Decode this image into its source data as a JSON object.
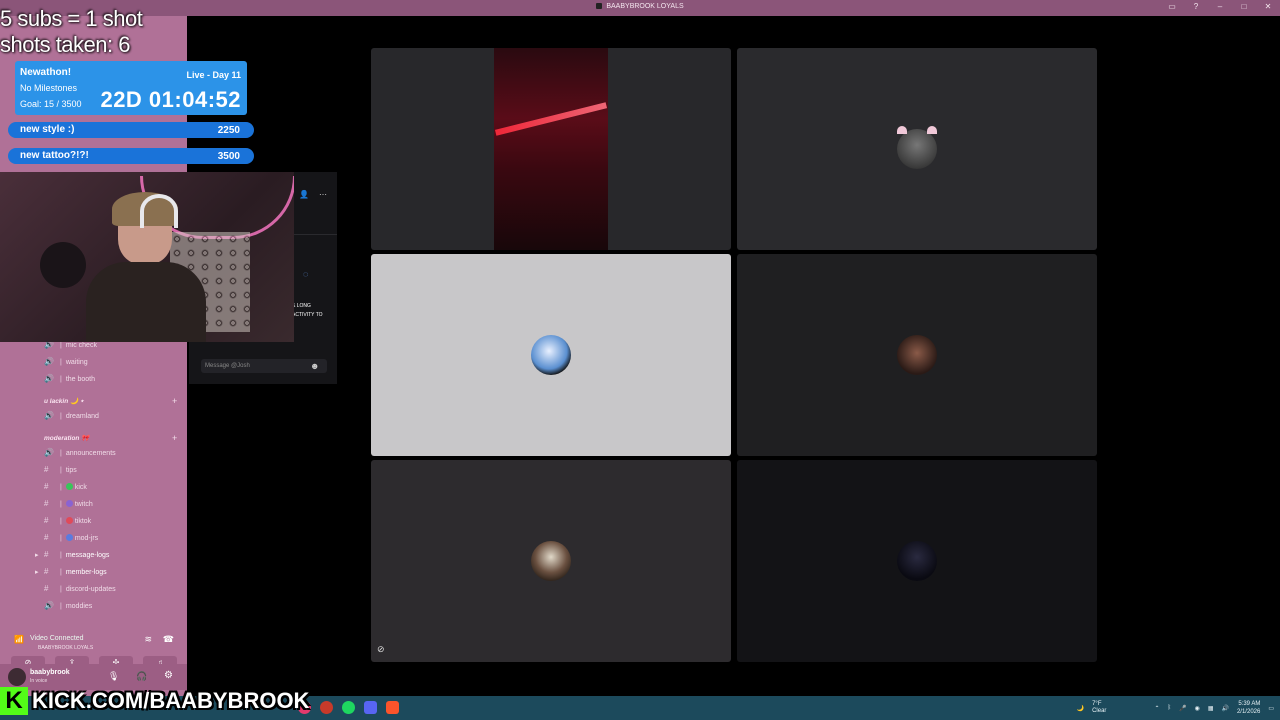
{
  "window": {
    "title": "BAABYBROOK LOYALS",
    "controls": [
      "▭",
      "?",
      "–",
      "□",
      "✕"
    ]
  },
  "overlay": {
    "subs_rule": "5 subs = 1 shot",
    "shots_taken": "shots taken: 6",
    "newathon": {
      "title": "Newathon!",
      "milestones": "No Milestones",
      "goal": "Goal: 15 / 3500",
      "live_day": "Live - Day 11",
      "timer": "22D 01:04:52"
    },
    "goals": [
      {
        "label": "new style :)",
        "value": "2250"
      },
      {
        "label": "new tattoo?!?!",
        "value": "3500"
      }
    ],
    "kick_url": "KICK.COM/BAABYBROOK"
  },
  "sidebar": {
    "channels": [
      {
        "icon": "speaker-icon",
        "name": "mic check"
      },
      {
        "icon": "speaker-icon",
        "name": "waiting"
      },
      {
        "icon": "speaker-icon",
        "name": "the booth"
      }
    ],
    "category1": "u lackin 🌙 ⋆",
    "cat1_channels": [
      {
        "icon": "speaker-icon",
        "name": "dreamland"
      }
    ],
    "category2": "moderation 🎀",
    "text_channels": [
      {
        "icon": "speaker-icon",
        "name": "announcements",
        "dot": ""
      },
      {
        "icon": "hash-icon",
        "name": "tips",
        "dot": ""
      },
      {
        "icon": "hash-icon",
        "name": "kick",
        "dot": "#39c55a"
      },
      {
        "icon": "hash-icon",
        "name": "twitch",
        "dot": "#8a63d2"
      },
      {
        "icon": "hash-icon",
        "name": "tiktok",
        "dot": "#e04a5a"
      },
      {
        "icon": "hash-icon",
        "name": "mod-jrs",
        "dot": "#5a7be0"
      },
      {
        "icon": "hash-icon",
        "name": "message-logs",
        "dot": "",
        "bright": true
      },
      {
        "icon": "hash-icon",
        "name": "member-logs",
        "dot": "",
        "bright": true
      },
      {
        "icon": "hash-icon",
        "name": "discord-updates",
        "dot": ""
      },
      {
        "icon": "speaker-icon",
        "name": "moddies",
        "dot": ""
      }
    ],
    "voice": {
      "status": "Video Connected",
      "location": "BAABYBROOK LOYALS"
    },
    "user": {
      "name": "baabybrook",
      "status": "In voice"
    }
  },
  "chat": {
    "placeholder": "Message @Josh",
    "overlay_text_1": "& LONG",
    "overlay_text_2": "ACTIVITY TO"
  },
  "taskbar": {
    "weather": "7°F",
    "weather_desc": "Clear",
    "time": "5:39 AM",
    "date": "2/1/2026"
  },
  "colors": {
    "sidebar": "#b07197",
    "titlebar": "#8b5579",
    "taskbar": "#1c4a5c",
    "goal_bar": "#2c93e8",
    "kick_green": "#53fc18"
  }
}
